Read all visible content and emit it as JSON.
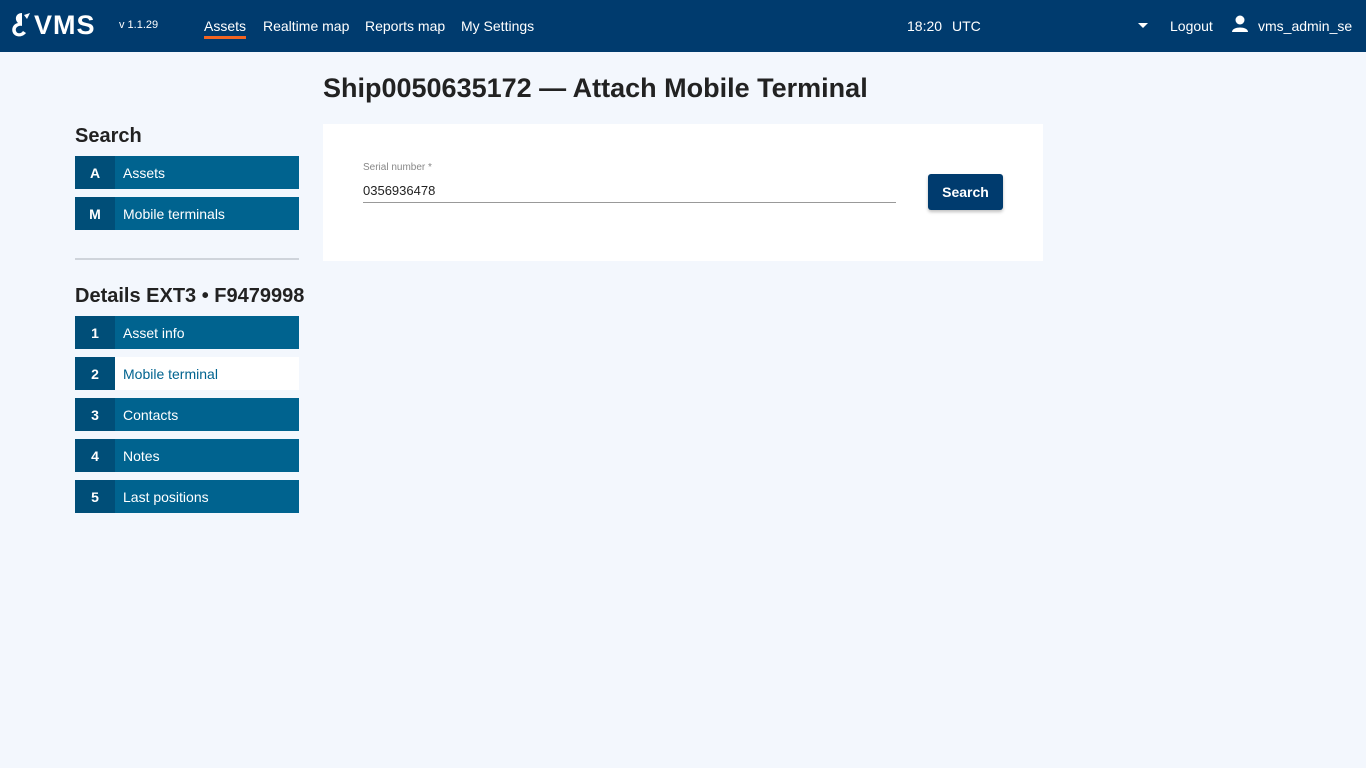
{
  "header": {
    "logo_text": "VMS",
    "version": "v 1.1.29",
    "nav": [
      "Assets",
      "Realtime map",
      "Reports map",
      "My Settings"
    ],
    "active_nav": "Assets",
    "time": "18:20",
    "timezone": "UTC",
    "logout_label": "Logout",
    "username": "vms_admin_se"
  },
  "sidebar": {
    "search_title": "Search",
    "search_items": [
      {
        "key": "A",
        "label": "Assets"
      },
      {
        "key": "M",
        "label": "Mobile terminals"
      }
    ],
    "details_title": "Details EXT3 • F9479998",
    "detail_items": [
      {
        "key": "1",
        "label": "Asset info"
      },
      {
        "key": "2",
        "label": "Mobile terminal",
        "selected": true
      },
      {
        "key": "3",
        "label": "Contacts"
      },
      {
        "key": "4",
        "label": "Notes"
      },
      {
        "key": "5",
        "label": "Last positions"
      }
    ]
  },
  "main": {
    "title": "Ship0050635172 — Attach Mobile Terminal",
    "serial_label": "Serial number *",
    "serial_value": "0356936478",
    "search_button": "Search"
  },
  "colors": {
    "header_bg": "#003b6e",
    "menu_bg": "#00638f",
    "menu_key_bg": "#004e78",
    "active_underline": "#f26522",
    "page_bg": "#f3f7fd"
  }
}
